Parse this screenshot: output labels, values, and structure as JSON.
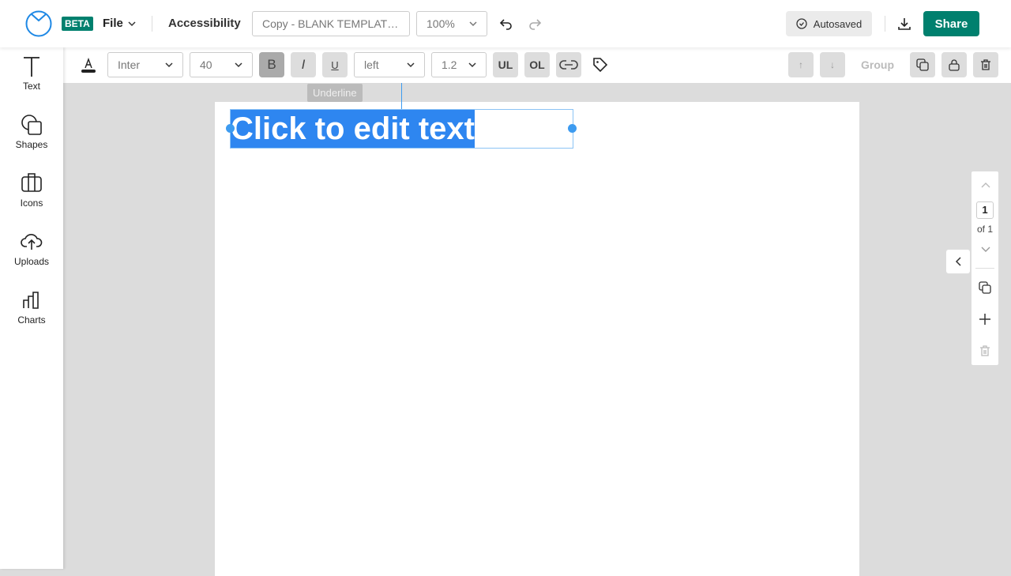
{
  "header": {
    "beta": "BETA",
    "file": "File",
    "accessibility": "Accessibility",
    "doc_name": "Copy - BLANK TEMPLAT…",
    "zoom": "100%",
    "autosaved": "Autosaved",
    "share": "Share",
    "brand_color": "#00806e"
  },
  "sidebar": {
    "items": [
      {
        "label": "Text",
        "icon": "text-icon"
      },
      {
        "label": "Shapes",
        "icon": "shapes-icon"
      },
      {
        "label": "Icons",
        "icon": "icons-icon"
      },
      {
        "label": "Uploads",
        "icon": "upload-icon"
      },
      {
        "label": "Charts",
        "icon": "chart-icon"
      }
    ]
  },
  "toolbar": {
    "font": "Inter",
    "size": "40",
    "bold": "B",
    "italic": "I",
    "underline": "U",
    "align": "left",
    "line_height": "1.2",
    "ul": "UL",
    "ol": "OL",
    "up": "↑",
    "down": "↓",
    "group": "Group",
    "tooltip": "Underline"
  },
  "canvas": {
    "text": "Click to edit text"
  },
  "pager": {
    "page": "1",
    "of": "of 1"
  }
}
